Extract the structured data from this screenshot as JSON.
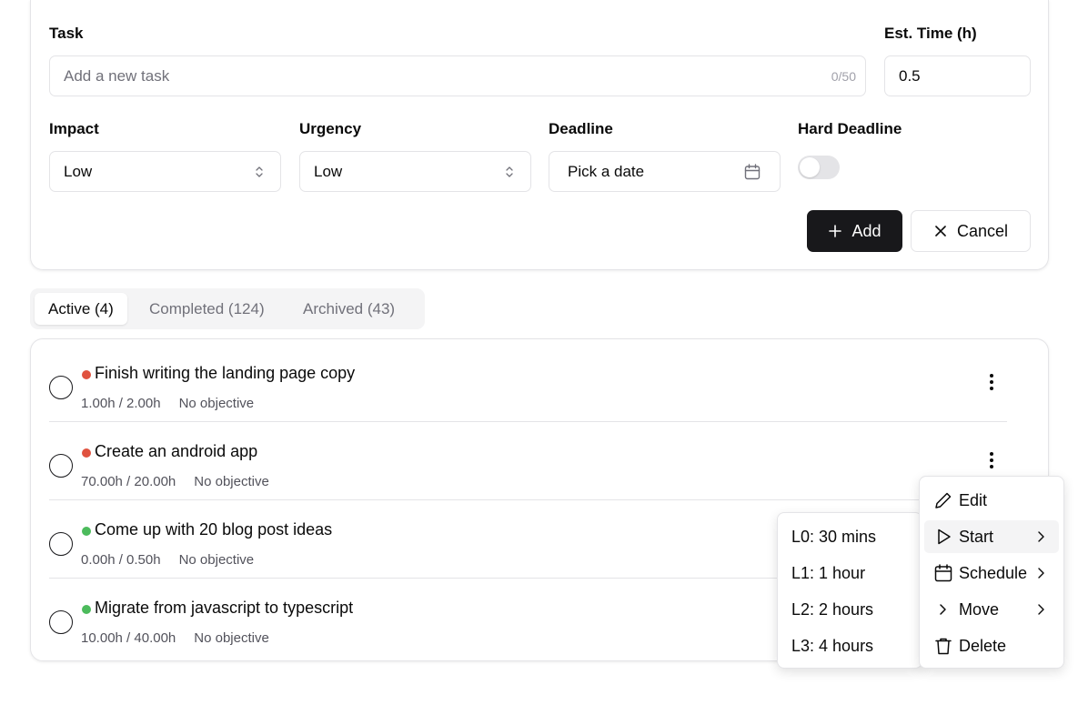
{
  "form": {
    "task_label": "Task",
    "task_placeholder": "Add a new task",
    "task_counter": "0/50",
    "est_label": "Est. Time (h)",
    "est_value": "0.5",
    "impact_label": "Impact",
    "impact_value": "Low",
    "urgency_label": "Urgency",
    "urgency_value": "Low",
    "deadline_label": "Deadline",
    "deadline_placeholder": "Pick a date",
    "hard_deadline_label": "Hard Deadline",
    "hard_deadline_on": false,
    "add_label": "Add",
    "cancel_label": "Cancel"
  },
  "tabs": [
    {
      "label": "Active (4)",
      "active": true
    },
    {
      "label": "Completed (124)",
      "active": false
    },
    {
      "label": "Archived (43)",
      "active": false
    }
  ],
  "tasks": [
    {
      "title": "Finish writing the landing page copy",
      "time": "1.00h / 2.00h",
      "objective": "No objective",
      "priority_color": "#e0523f"
    },
    {
      "title": "Create an android app",
      "time": "70.00h / 20.00h",
      "objective": "No objective",
      "priority_color": "#e0523f"
    },
    {
      "title": "Come up with 20 blog post ideas",
      "time": "0.00h / 0.50h",
      "objective": "No objective",
      "priority_color": "#4cbb5c"
    },
    {
      "title": "Migrate from javascript to typescript",
      "time": "10.00h / 40.00h",
      "objective": "No objective",
      "priority_color": "#4cbb5c"
    }
  ],
  "context_menu": {
    "items": [
      {
        "label": "Edit",
        "icon": "pencil-icon"
      },
      {
        "label": "Start",
        "icon": "play-icon"
      },
      {
        "label": "Schedule",
        "icon": "calendar-icon"
      },
      {
        "label": "Move",
        "icon": "chevron-right-icon"
      },
      {
        "label": "Delete",
        "icon": "trash-icon"
      }
    ]
  },
  "start_submenu": {
    "items": [
      "L0: 30 mins",
      "L1: 1 hour",
      "L2: 2 hours",
      "L3: 4 hours"
    ]
  }
}
